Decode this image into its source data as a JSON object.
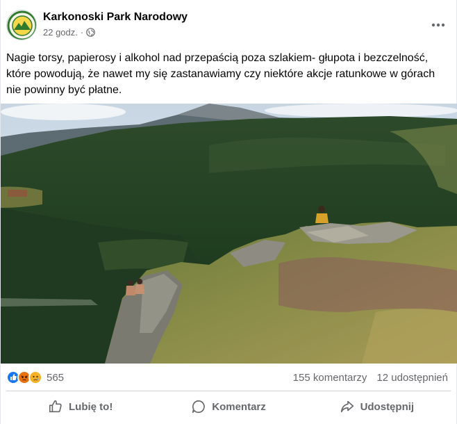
{
  "post": {
    "author": "Karkonoski Park Narodowy",
    "time": "22 godz.",
    "separator": "·",
    "privacy_icon": "globe-icon",
    "menu_icon": "more-dots-icon",
    "text": "Nagie torsy, papierosy i alkohol nad przepaścią poza szlakiem- głupota i bezczelność, które powodują, że  nawet my się zastanawiamy czy niektóre akcje ratunkowe w górach nie powinny być płatne."
  },
  "stats": {
    "reaction_icons": [
      "like-icon",
      "angry-icon",
      "sad-icon"
    ],
    "reaction_count": "565",
    "comments": "155 komentarzy",
    "shares": "12 udostępnień"
  },
  "actions": {
    "like": "Lubię to!",
    "comment": "Komentarz",
    "share": "Udostępnij"
  },
  "colors": {
    "like_blue": "#1877f2",
    "angry_orange": "#e9710f",
    "sad_yellow": "#f7b125",
    "muted_text": "#65676b"
  }
}
